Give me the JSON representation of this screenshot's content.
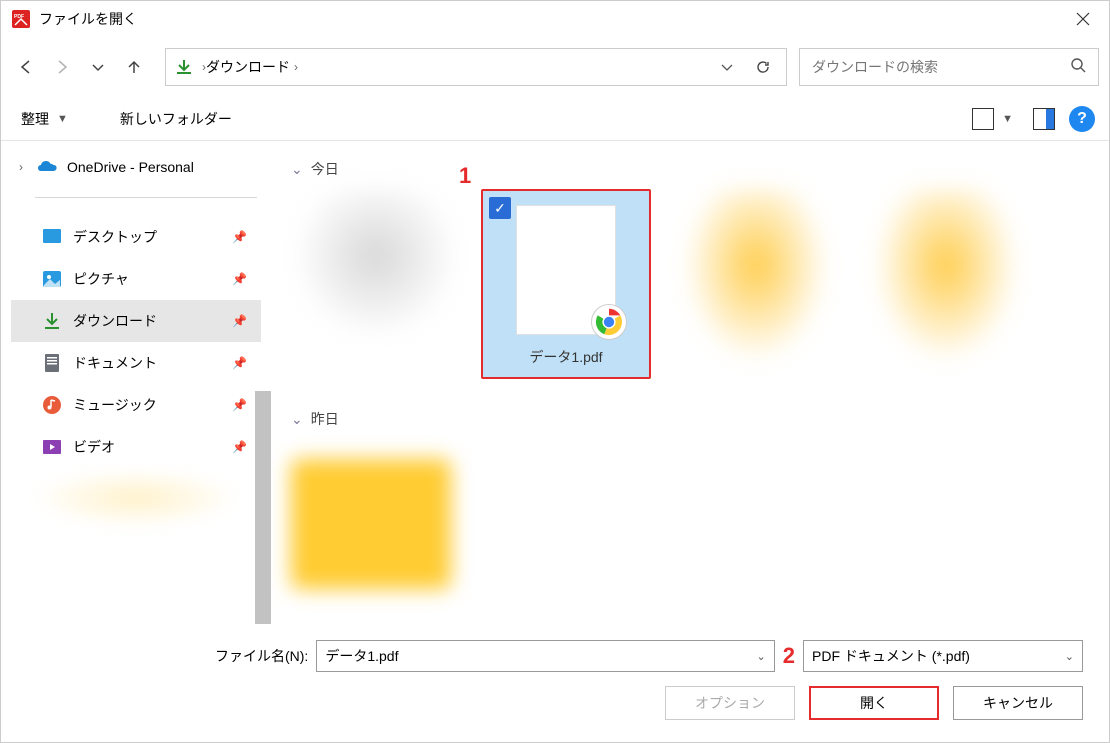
{
  "title": "ファイルを開く",
  "breadcrumb": {
    "folder": "ダウンロード"
  },
  "search": {
    "placeholder": "ダウンロードの検索"
  },
  "toolbar": {
    "organize": "整理",
    "new_folder": "新しいフォルダー"
  },
  "tree": {
    "onedrive": "OneDrive - Personal"
  },
  "quick_access": {
    "desktop": "デスクトップ",
    "pictures": "ピクチャ",
    "downloads": "ダウンロード",
    "documents": "ドキュメント",
    "music": "ミュージック",
    "video": "ビデオ"
  },
  "groups": {
    "today": "今日",
    "yesterday": "昨日"
  },
  "files": {
    "selected_name": "データ1.pdf"
  },
  "annotations": {
    "n1": "1",
    "n2": "2"
  },
  "footer": {
    "filename_label": "ファイル名(N):",
    "filename_value": "データ1.pdf",
    "filter": "PDF ドキュメント (*.pdf)",
    "options_btn": "オプション",
    "open_btn": "開く",
    "cancel_btn": "キャンセル"
  }
}
